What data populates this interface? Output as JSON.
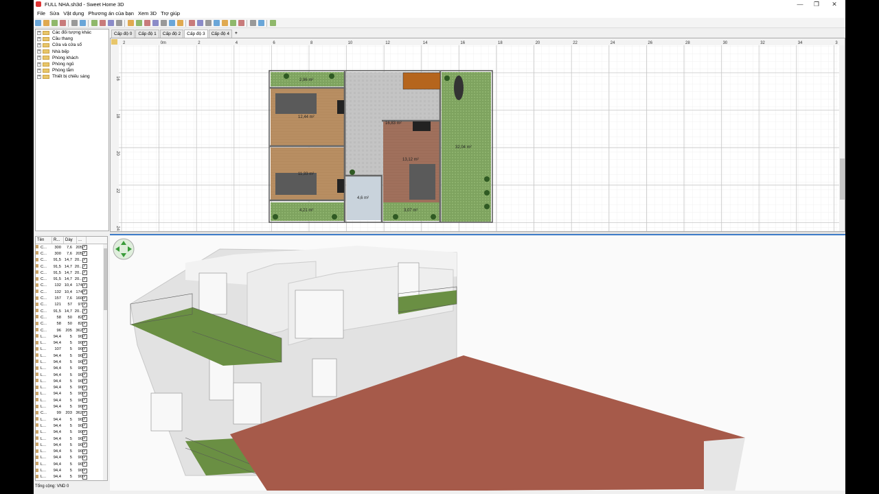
{
  "window": {
    "title": "FULL NHA.sh3d - Sweet Home 3D",
    "controls": {
      "minimize": "—",
      "restore": "❐",
      "close": "✕"
    }
  },
  "menu": [
    "File",
    "Sửa",
    "Vật dụng",
    "Phương án của bạn",
    "Xem 3D",
    "Trợ giúp"
  ],
  "toolbar_icons": [
    "new-icon",
    "open-icon",
    "save-icon",
    "save-as-icon",
    "sep",
    "undo-icon",
    "redo-icon",
    "sep",
    "cut-icon",
    "copy-icon",
    "paste-icon",
    "add-furniture-icon",
    "sep",
    "select-icon",
    "pan-icon",
    "create-walls-icon",
    "create-rooms-icon",
    "create-polylines-icon",
    "create-dimensions-icon",
    "create-labels-icon",
    "sep",
    "text-style-icon",
    "text-bold-icon",
    "text-italic-icon",
    "increase-text-icon",
    "decrease-text-icon",
    "zoom-in-icon",
    "zoom-out-icon",
    "sep",
    "photo-icon",
    "video-icon",
    "sep",
    "help-icon"
  ],
  "catalog": {
    "items": [
      "Các đối tượng khác",
      "Cầu thang",
      "Cửa và cửa sổ",
      "Nhà bếp",
      "Phòng khách",
      "Phòng ngủ",
      "Phòng tắm",
      "Thiết bị chiếu sáng"
    ]
  },
  "plan_tabs": [
    "Cấp độ 0",
    "Cấp độ 1",
    "Cấp độ 2",
    "Cấp độ 3",
    "Cấp độ 4",
    "+"
  ],
  "plan_active_tab": 3,
  "ruler_x": [
    "2",
    "0m",
    "2",
    "4",
    "6",
    "8",
    "10",
    "12",
    "14",
    "16",
    "18",
    "20",
    "22",
    "24",
    "26",
    "28",
    "30",
    "32",
    "34",
    "3"
  ],
  "ruler_y": [
    "16",
    "18",
    "20",
    "22",
    "24"
  ],
  "rooms": [
    {
      "area": "2,96 m²"
    },
    {
      "area": "12,44 m²"
    },
    {
      "area": "11,33 m²"
    },
    {
      "area": "16,83 m²"
    },
    {
      "area": "13,12 m²"
    },
    {
      "area": "32,04 m²"
    },
    {
      "area": "4,6 m²"
    },
    {
      "area": "4,21 m²"
    },
    {
      "area": "3,07 m²"
    }
  ],
  "furniture_table": {
    "headers": [
      "Tên",
      "R...",
      "Dày",
      "..."
    ],
    "rows": [
      [
        "C...",
        "300",
        "7,6",
        "205"
      ],
      [
        "C...",
        "300",
        "7,6",
        "205"
      ],
      [
        "C...",
        "91,5",
        "14,7",
        "20..."
      ],
      [
        "C...",
        "91,5",
        "14,7",
        "20..."
      ],
      [
        "C...",
        "91,5",
        "14,7",
        "20..."
      ],
      [
        "C...",
        "91,5",
        "14,7",
        "20..."
      ],
      [
        "C...",
        "132",
        "10,4",
        "174"
      ],
      [
        "C...",
        "132",
        "10,4",
        "174"
      ],
      [
        "C...",
        "157",
        "7,6",
        "160"
      ],
      [
        "C...",
        "121",
        "57",
        "97"
      ],
      [
        "C...",
        "91,5",
        "14,7",
        "20..."
      ],
      [
        "C...",
        "58",
        "50",
        "82"
      ],
      [
        "C...",
        "58",
        "50",
        "82"
      ],
      [
        "C...",
        "96",
        "205",
        "362"
      ],
      [
        "L...",
        "94,4",
        "5",
        "90"
      ],
      [
        "L...",
        "94,4",
        "5",
        "90"
      ],
      [
        "L...",
        "107",
        "5",
        "90"
      ],
      [
        "L...",
        "94,4",
        "5",
        "90"
      ],
      [
        "L...",
        "94,4",
        "5",
        "90"
      ],
      [
        "L...",
        "94,4",
        "5",
        "90"
      ],
      [
        "L...",
        "94,4",
        "5",
        "90"
      ],
      [
        "L...",
        "94,4",
        "5",
        "90"
      ],
      [
        "L...",
        "94,4",
        "5",
        "90"
      ],
      [
        "L...",
        "94,4",
        "5",
        "90"
      ],
      [
        "L...",
        "94,4",
        "5",
        "90"
      ],
      [
        "L...",
        "94,4",
        "5",
        "90"
      ],
      [
        "C...",
        "99",
        "203",
        "362"
      ],
      [
        "L...",
        "94,4",
        "5",
        "90"
      ],
      [
        "L...",
        "94,4",
        "5",
        "90"
      ],
      [
        "L...",
        "94,4",
        "5",
        "90"
      ],
      [
        "L...",
        "94,4",
        "5",
        "90"
      ],
      [
        "L...",
        "94,4",
        "5",
        "90"
      ],
      [
        "L...",
        "94,4",
        "5",
        "90"
      ],
      [
        "L...",
        "94,4",
        "5",
        "90"
      ],
      [
        "L...",
        "94,4",
        "5",
        "90"
      ],
      [
        "L...",
        "94,4",
        "5",
        "90"
      ],
      [
        "L...",
        "94,4",
        "5",
        "90"
      ],
      [
        "L...",
        "94,4",
        "5",
        "90"
      ]
    ]
  },
  "status": "Tổng cộng:   VND 0",
  "colors": {
    "wall": "#777777",
    "grass": "#7aa05e",
    "wood": "#b8906a",
    "tile": "#c0c0c0",
    "roof": "#a65a4a",
    "accent": "#3b7bc8"
  }
}
